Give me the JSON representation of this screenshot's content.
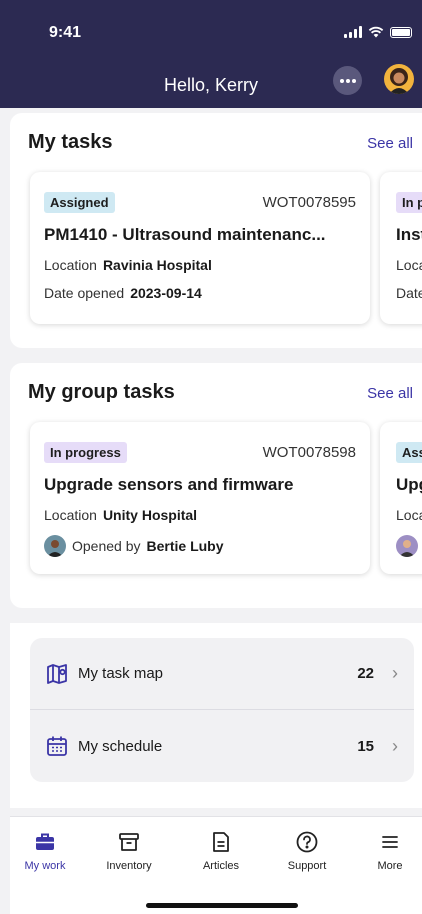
{
  "status": {
    "time": "9:41"
  },
  "header": {
    "greeting": "Hello, Kerry"
  },
  "my_tasks": {
    "title": "My tasks",
    "see_all": "See all",
    "cards": [
      {
        "status": "Assigned",
        "number": "WOT0078595",
        "title": "PM1410 - Ultrasound maintenanc...",
        "location_label": "Location",
        "location": "Ravinia Hospital",
        "date_label": "Date opened",
        "date": "2023-09-14"
      },
      {
        "status": "In p",
        "title": "Inst",
        "location_label": "Loca",
        "date_label": "Date"
      }
    ]
  },
  "group_tasks": {
    "title": "My group tasks",
    "see_all": "See all",
    "cards": [
      {
        "status": "In progress",
        "number": "WOT0078598",
        "title": "Upgrade sensors and firmware",
        "location_label": "Location",
        "location": "Unity Hospital",
        "opened_by_label": "Opened by",
        "opened_by": "Bertie Luby"
      },
      {
        "status": "Ass",
        "title": "Upg",
        "location_label": "Loca"
      }
    ]
  },
  "links": [
    {
      "label": "My task map",
      "count": "22",
      "icon": "map-icon"
    },
    {
      "label": "My schedule",
      "count": "15",
      "icon": "calendar-icon"
    }
  ],
  "tabs": [
    {
      "label": "My work",
      "icon": "briefcase-icon",
      "active": true
    },
    {
      "label": "Inventory",
      "icon": "archive-box-icon"
    },
    {
      "label": "Articles",
      "icon": "document-icon"
    },
    {
      "label": "Support",
      "icon": "help-circle-icon"
    },
    {
      "label": "More",
      "icon": "hamburger-menu-icon"
    }
  ],
  "colors": {
    "header_bg": "#2c2a52",
    "accent": "#3b35a6",
    "badge_assigned": "#cfe9f3",
    "badge_in_progress": "#e6dcf8"
  }
}
